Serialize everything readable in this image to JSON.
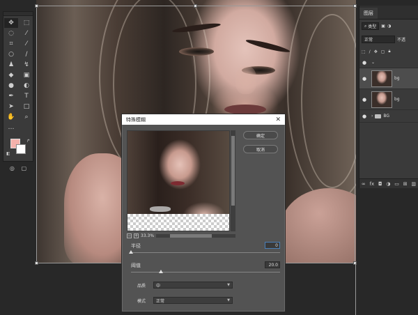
{
  "toolbar": {
    "tools": [
      "move-icon",
      "marquee-icon",
      "lasso-icon",
      "magic-wand-icon",
      "crop-icon",
      "eyedropper-icon",
      "ellipse-icon",
      "brush-icon",
      "stamp-icon",
      "history-brush-icon",
      "eraser-icon",
      "gradient-icon",
      "blur-icon",
      "dodge-icon",
      "pen-icon",
      "type-icon",
      "path-select-icon",
      "rectangle-icon",
      "hand-icon",
      "zoom-icon",
      "more-icon"
    ],
    "colors": {
      "foreground": "#f4b2ac",
      "background": "#ffffff"
    }
  },
  "layers": {
    "tab_label": "图层",
    "filter_label": "类型",
    "blend_mode": "正常",
    "opacity_label": "不透",
    "items": [
      {
        "name": "bg",
        "selected": true
      },
      {
        "name": "bg",
        "selected": false
      }
    ],
    "group_name": "BG",
    "footer": [
      "link-icon",
      "fx",
      "mask-icon",
      "adjustment-icon",
      "folder-icon",
      "new-layer-icon",
      "trash-icon"
    ]
  },
  "dialog": {
    "title": "特殊模糊",
    "close": "✕",
    "ok_label": "确定",
    "cancel_label": "取消",
    "zoom_value": "33.3%",
    "radius": {
      "label": "半径",
      "value": "0",
      "fraction": 0.0
    },
    "threshold": {
      "label": "阈值",
      "value": "20.0",
      "fraction": 0.2
    },
    "quality": {
      "label": "品质",
      "value": "中"
    },
    "mode": {
      "label": "模式",
      "value": "正常"
    }
  }
}
